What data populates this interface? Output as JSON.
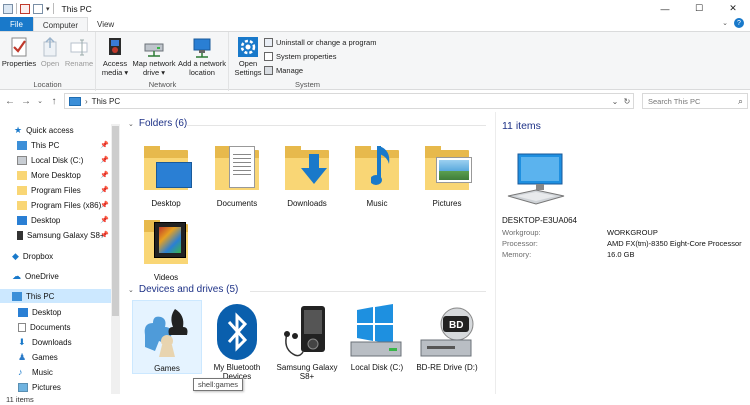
{
  "window": {
    "title": "This PC",
    "controls": [
      "minimize-icon",
      "maximize-icon",
      "close-icon"
    ]
  },
  "ribbon": {
    "tabs": [
      "File",
      "Computer",
      "View"
    ],
    "active_tab": "Computer",
    "groups": {
      "location": {
        "label": "Location",
        "buttons": [
          {
            "label": "Properties",
            "icon": "properties-checkmark-icon",
            "enabled": true
          },
          {
            "label": "Open",
            "icon": "open-icon",
            "enabled": false
          },
          {
            "label": "Rename",
            "icon": "rename-icon",
            "enabled": false
          }
        ]
      },
      "network": {
        "label": "Network",
        "buttons": [
          {
            "label": "Access\nmedia ▾",
            "icon": "media-icon"
          },
          {
            "label": "Map network\ndrive ▾",
            "icon": "network-drive-icon"
          },
          {
            "label": "Add a network\nlocation",
            "icon": "network-location-icon"
          }
        ]
      },
      "system": {
        "label": "System",
        "open_settings": "Open\nSettings",
        "items": [
          "Uninstall or change a program",
          "System properties",
          "Manage"
        ]
      }
    }
  },
  "address": {
    "path": "This PC",
    "search_placeholder": "Search This PC"
  },
  "nav_pane": {
    "quick_access": "Quick access",
    "items": [
      {
        "label": "This PC",
        "pinned": true
      },
      {
        "label": "Local Disk (C:)",
        "pinned": true
      },
      {
        "label": "More Desktop",
        "pinned": true
      },
      {
        "label": "Program Files",
        "pinned": true
      },
      {
        "label": "Program Files (x86)",
        "pinned": true
      },
      {
        "label": "Desktop",
        "pinned": true
      },
      {
        "label": "Samsung Galaxy S8+",
        "pinned": true
      }
    ],
    "dropbox": "Dropbox",
    "onedrive": "OneDrive",
    "this_pc": "This PC",
    "pc_children": [
      "Desktop",
      "Documents",
      "Downloads",
      "Games",
      "Music",
      "Pictures"
    ]
  },
  "content": {
    "folders_header": "Folders (6)",
    "folders": [
      "Desktop",
      "Documents",
      "Downloads",
      "Music",
      "Pictures",
      "Videos"
    ],
    "devices_header": "Devices and drives (5)",
    "devices": [
      "Games",
      "My Bluetooth\nDevices",
      "Samsung Galaxy\nS8+",
      "Local Disk (C:)",
      "BD-RE Drive (D:)"
    ],
    "tooltip": "shell:games"
  },
  "details": {
    "count": "11 items",
    "computer_name": "DESKTOP-E3UA064",
    "rows": [
      {
        "key": "Workgroup:",
        "value": "WORKGROUP"
      },
      {
        "key": "Processor:",
        "value": "AMD FX(tm)-8350 Eight-Core Processor"
      },
      {
        "key": "Memory:",
        "value": "16.0 GB"
      }
    ]
  },
  "status": {
    "items": "11 items"
  },
  "colors": {
    "accent": "#1979ca",
    "header_text": "#1e3287",
    "folder_yellow": "#f9d675",
    "selection": "#cce8ff"
  }
}
